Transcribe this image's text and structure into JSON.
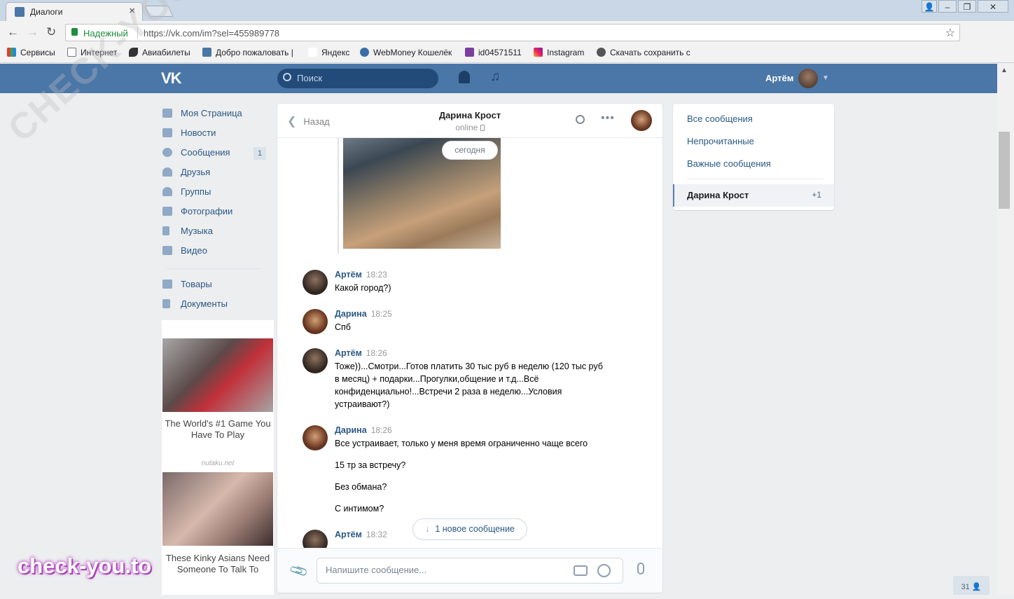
{
  "browser": {
    "tab_title": "Диалоги",
    "secure_label": "Надежный",
    "url": "https://vk.com/im?sel=455989778",
    "bookmarks": [
      "Сервисы",
      "Интернет",
      "Авиабилеты",
      "Добро пожаловать |",
      "Яндекс",
      "WebMoney Кошелёк",
      "id04571511",
      "Instagram",
      "Скачать сохранить с"
    ]
  },
  "header": {
    "logo": "VK",
    "search_placeholder": "Поиск",
    "user_name": "Артём"
  },
  "left_nav": {
    "items": [
      {
        "label": "Моя Страница"
      },
      {
        "label": "Новости"
      },
      {
        "label": "Сообщения",
        "count": "1"
      },
      {
        "label": "Друзья"
      },
      {
        "label": "Группы"
      },
      {
        "label": "Фотографии"
      },
      {
        "label": "Музыка"
      },
      {
        "label": "Видео"
      },
      {
        "label": "Товары"
      },
      {
        "label": "Документы"
      }
    ]
  },
  "ads": {
    "ad1_text": "The World's #1 Game You Have To Play",
    "ad1_source": "nutaku.net",
    "ad2_text": "These Kinky Asians Need Someone To Talk To"
  },
  "chat": {
    "back_label": "Назад",
    "peer_name": "Дарина Крост",
    "peer_status": "online",
    "date_badge": "сегодня",
    "messages": [
      {
        "author": "Артём",
        "time": "18:23",
        "text": "Какой город?)"
      },
      {
        "author": "Дарина",
        "time": "18:25",
        "text": "Спб"
      },
      {
        "author": "Артём",
        "time": "18:26",
        "text": "Тоже))...Смотри...Готов платить 30 тыс руб в неделю (120 тыс руб в месяц) + подарки...Прогулки,общение и т.д...Всё конфиденциально!...Встречи 2 раза в неделю...Условия устраивают?)"
      },
      {
        "author": "Дарина",
        "time": "18:26",
        "text": "Все устраивает, только у меня время ограниченно чаще всего",
        "extra": [
          "15 тр за встречу?",
          "Без обмана?",
          "С интимом?"
        ]
      },
      {
        "author": "Артём",
        "time": "18:32",
        "text": ""
      }
    ],
    "new_message_pill": "1 новое сообщение",
    "composer_placeholder": "Напишите сообщение..."
  },
  "right_panel": {
    "links": [
      "Все сообщения",
      "Непрочитанные",
      "Важные сообщения"
    ],
    "selected_name": "Дарина Крост",
    "selected_count": "+1"
  },
  "counter": "31",
  "watermarks": {
    "diagonal": "CHECK-YOU.ME",
    "brand": "check-you.to"
  }
}
